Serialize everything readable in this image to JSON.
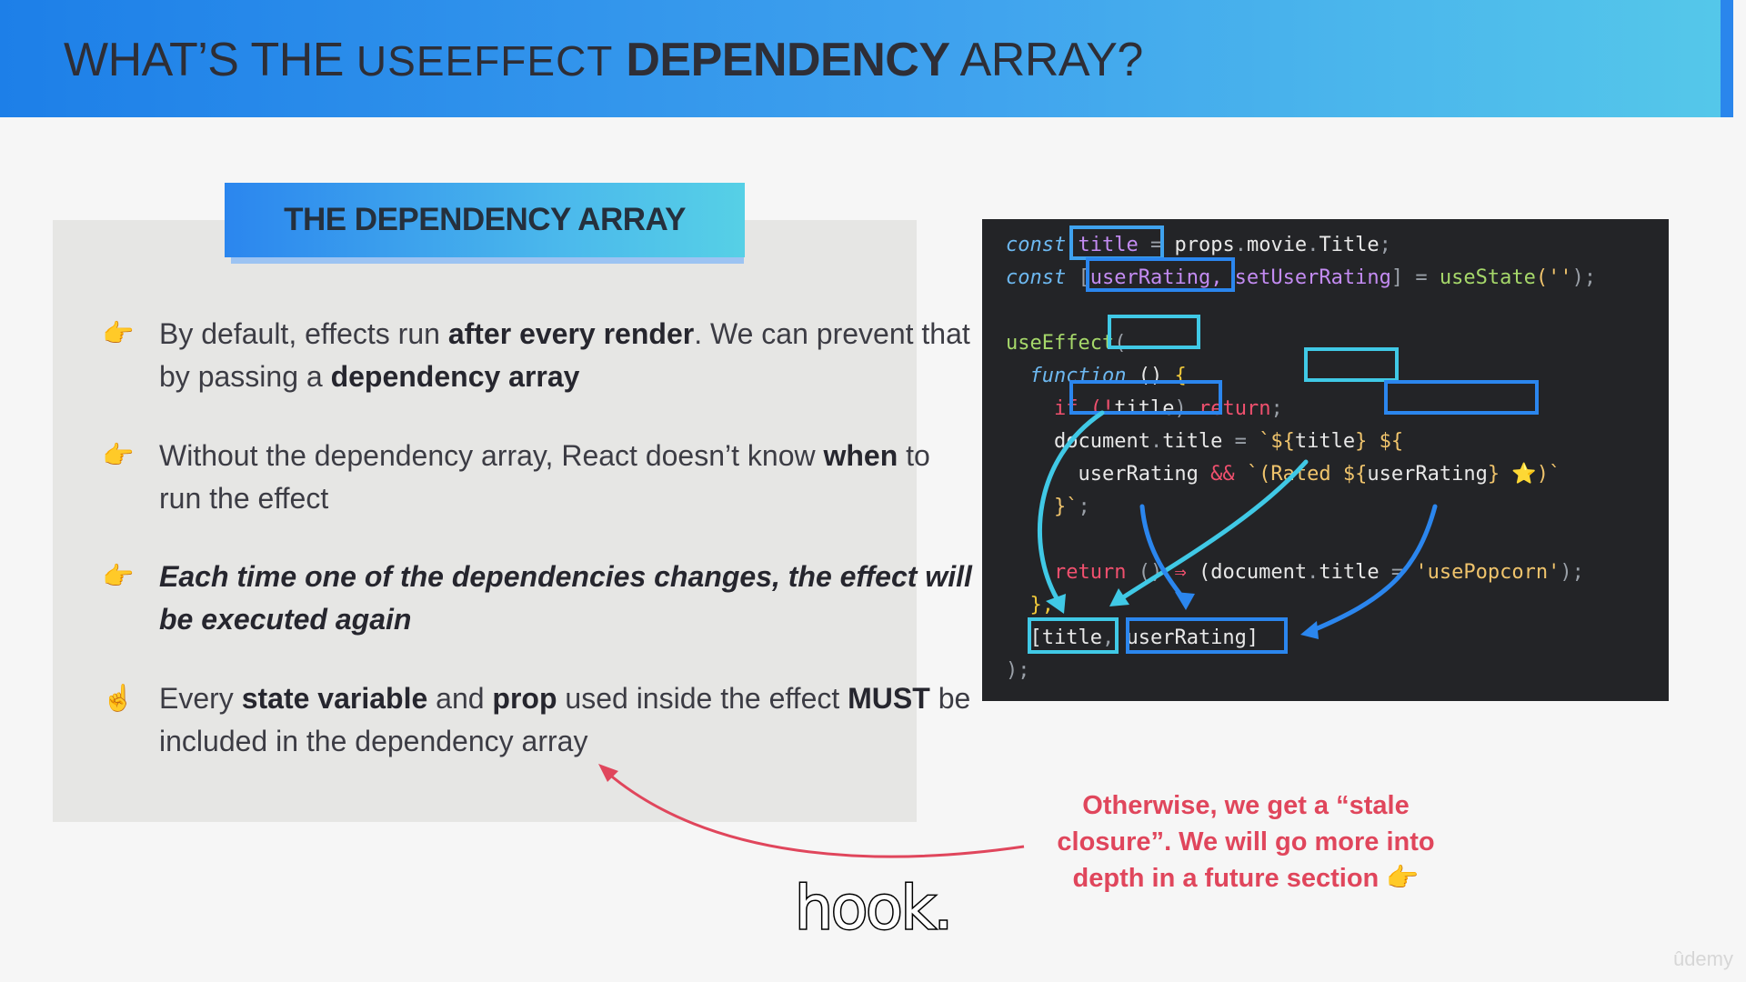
{
  "slide": {
    "title_part1": "WHAT’S THE ",
    "title_part2": "USEEFFECT",
    "title_part3": " DEPENDENCY",
    "title_part4": " ARRAY?"
  },
  "section_label": "THE DEPENDENCY ARRAY",
  "bullets": [
    {
      "icon": "pointing-hand-icon",
      "glyph": "👉",
      "segments": [
        {
          "t": "By default, effects run ",
          "s": "n"
        },
        {
          "t": "after every render",
          "s": "b"
        },
        {
          "t": ". We can prevent that by passing a ",
          "s": "n"
        },
        {
          "t": "dependency array",
          "s": "b"
        }
      ]
    },
    {
      "icon": "pointing-hand-icon",
      "glyph": "👉",
      "segments": [
        {
          "t": "Without the dependency array, React doesn’t know ",
          "s": "n"
        },
        {
          "t": "when",
          "s": "b"
        },
        {
          "t": " to run the effect",
          "s": "n"
        }
      ]
    },
    {
      "icon": "pointing-hand-icon",
      "glyph": "👉",
      "segments": [
        {
          "t": "Each time one of the dependencies changes, the effect will be executed again",
          "s": "bi"
        }
      ]
    },
    {
      "icon": "index-pointing-up-icon",
      "glyph": "☝️",
      "segments": [
        {
          "t": "Every ",
          "s": "n"
        },
        {
          "t": "state variable",
          "s": "b"
        },
        {
          "t": " and ",
          "s": "n"
        },
        {
          "t": "prop",
          "s": "b"
        },
        {
          "t": " used inside the effect ",
          "s": "n"
        },
        {
          "t": "MUST",
          "s": "b"
        },
        {
          "t": " be included in the dependency array",
          "s": "n"
        }
      ]
    }
  ],
  "code_lines": [
    [
      {
        "t": "const",
        "c": "kw"
      },
      {
        "t": " title",
        "c": "var"
      },
      {
        "t": " =",
        "c": "op"
      },
      {
        "t": " props",
        "c": "txt"
      },
      {
        "t": ".",
        "c": "op"
      },
      {
        "t": "movie",
        "c": "txt"
      },
      {
        "t": ".",
        "c": "op"
      },
      {
        "t": "Title",
        "c": "txt"
      },
      {
        "t": ";",
        "c": "op"
      }
    ],
    [
      {
        "t": "const",
        "c": "kw"
      },
      {
        "t": " [",
        "c": "op"
      },
      {
        "t": "userRating",
        "c": "var"
      },
      {
        "t": ", setUserRating",
        "c": "var"
      },
      {
        "t": "]",
        "c": "op"
      },
      {
        "t": " =",
        "c": "op"
      },
      {
        "t": " useState",
        "c": "fn"
      },
      {
        "t": "(''",
        "c": "str"
      },
      {
        "t": ");",
        "c": "op"
      }
    ],
    [],
    [
      {
        "t": "useEffect",
        "c": "fn"
      },
      {
        "t": "(",
        "c": "op"
      }
    ],
    [
      {
        "t": "  function",
        "c": "kw"
      },
      {
        "t": " ()",
        "c": "txt"
      },
      {
        "t": " {",
        "c": "brace"
      }
    ],
    [
      {
        "t": "    if",
        "c": "ret"
      },
      {
        "t": " (!",
        "c": "ret"
      },
      {
        "t": "title",
        "c": "txt"
      },
      {
        "t": ")",
        "c": "op"
      },
      {
        "t": " return",
        "c": "ret"
      },
      {
        "t": ";",
        "c": "op"
      }
    ],
    [
      {
        "t": "    document",
        "c": "txt"
      },
      {
        "t": ".",
        "c": "op"
      },
      {
        "t": "title",
        "c": "txt"
      },
      {
        "t": " =",
        "c": "op"
      },
      {
        "t": " `${",
        "c": "str"
      },
      {
        "t": "title",
        "c": "txt"
      },
      {
        "t": "}",
        "c": "str"
      },
      {
        "t": " ${",
        "c": "str"
      }
    ],
    [
      {
        "t": "      userRating",
        "c": "txt"
      },
      {
        "t": " &&",
        "c": "ret"
      },
      {
        "t": " `(Rated ${",
        "c": "str"
      },
      {
        "t": "userRating",
        "c": "txt"
      },
      {
        "t": "} ⭐)`",
        "c": "str"
      }
    ],
    [
      {
        "t": "    }`",
        "c": "str"
      },
      {
        "t": ";",
        "c": "op"
      }
    ],
    [],
    [
      {
        "t": "    return",
        "c": "ret"
      },
      {
        "t": " ()",
        "c": "op"
      },
      {
        "t": " ⇒",
        "c": "ret"
      },
      {
        "t": " (document",
        "c": "txt"
      },
      {
        "t": ".",
        "c": "op"
      },
      {
        "t": "title",
        "c": "txt"
      },
      {
        "t": " =",
        "c": "op"
      },
      {
        "t": " 'usePopcorn'",
        "c": "str"
      },
      {
        "t": ");",
        "c": "op"
      }
    ],
    [
      {
        "t": "  },",
        "c": "brace"
      }
    ],
    [
      {
        "t": "  [title",
        "c": "txt"
      },
      {
        "t": ", ",
        "c": "op"
      },
      {
        "t": "userRating]",
        "c": "txt"
      }
    ],
    [
      {
        "t": ");",
        "c": "op"
      }
    ]
  ],
  "code_colors": {
    "kw": "#6db8f0",
    "var": "#c38bf2",
    "op": "#9aa0a8",
    "txt": "#e8e8e8",
    "fn": "#a6d86a",
    "str": "#f0c46c",
    "ret": "#f0506e",
    "brace": "#f0c93a"
  },
  "otherwise_note": {
    "parts": [
      {
        "t": "Otherwise, we get a ",
        "s": "n"
      },
      {
        "t": "“stale closure”",
        "s": "b"
      },
      {
        "t": ". We will go more into depth in a future section 👉",
        "s": "n"
      }
    ]
  },
  "caption": "hook.",
  "watermark": "ûdemy",
  "colors": {
    "accent_blue": "#2b86ee",
    "accent_cyan": "#40c9e6",
    "note_red": "#e0465c"
  }
}
